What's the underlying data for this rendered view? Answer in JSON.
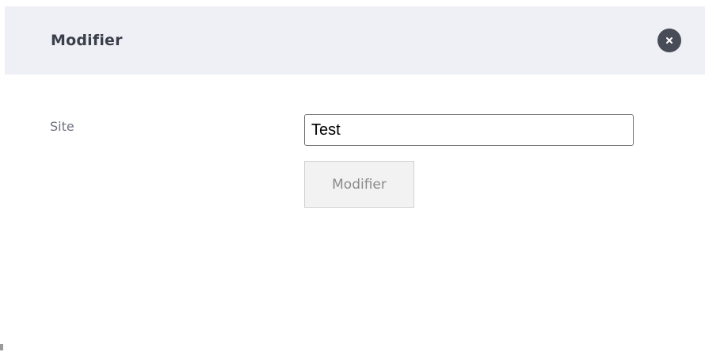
{
  "modal": {
    "title": "Modifier",
    "close_icon": "close-icon"
  },
  "form": {
    "site_label": "Site",
    "site_value": "Test",
    "submit_label": "Modifier"
  },
  "colors": {
    "header_bg": "#eef0f5",
    "title_text": "#3b3f4a",
    "close_bg": "#484c57",
    "label_text": "#6e7280",
    "button_bg": "#f2f2f2",
    "button_text": "#8a8a8a"
  }
}
